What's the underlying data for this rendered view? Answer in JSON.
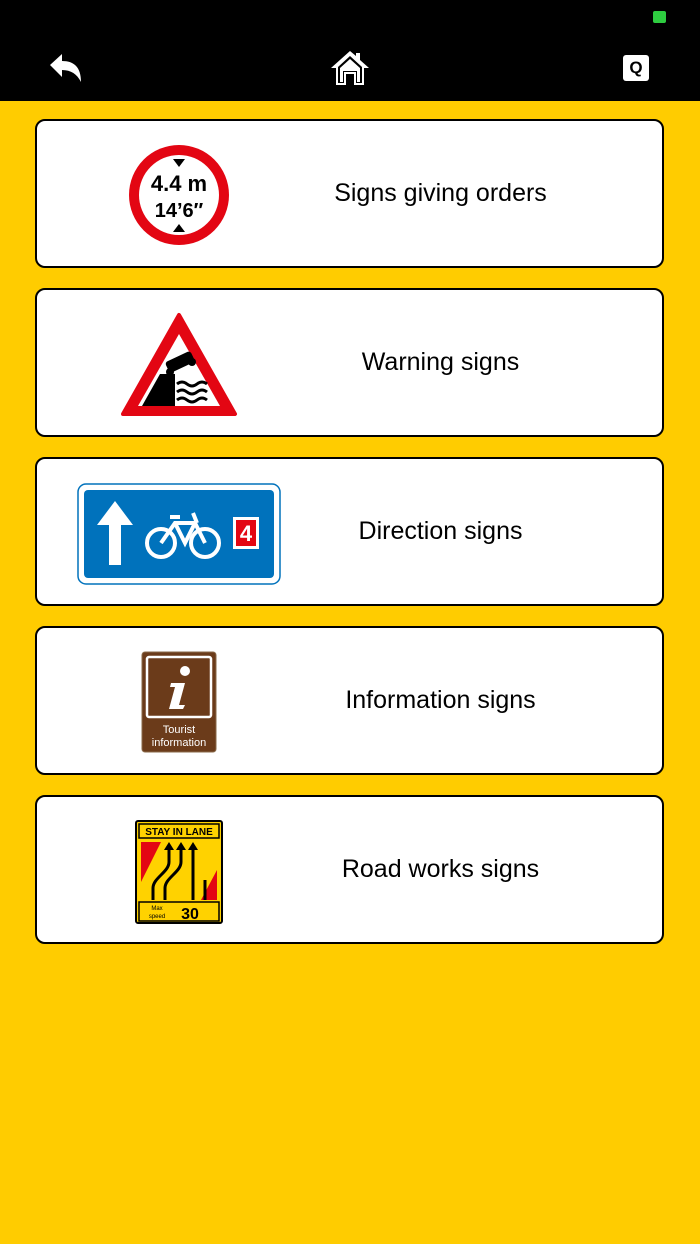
{
  "header": {
    "back_icon": "back-arrow-icon",
    "home_icon": "home-icon",
    "quiz_label": "Q"
  },
  "categories": [
    {
      "label": "Signs giving orders",
      "icon": "height-limit-sign-icon",
      "sign_text_top": "4.4 m",
      "sign_text_bottom": "14’6″"
    },
    {
      "label": "Warning signs",
      "icon": "quayside-warning-sign-icon"
    },
    {
      "label": "Direction signs",
      "icon": "cycle-route-sign-icon",
      "sign_text": "4"
    },
    {
      "label": "Information signs",
      "icon": "tourist-information-sign-icon",
      "sign_text_line1": "Tourist",
      "sign_text_line2": "information"
    },
    {
      "label": "Road works signs",
      "icon": "stay-in-lane-sign-icon",
      "sign_text_top": "STAY IN LANE",
      "sign_text_max": "Max",
      "sign_text_speed": "speed",
      "sign_text_value": "30"
    }
  ],
  "colors": {
    "background": "#FFCC00",
    "header": "#000000",
    "sign_red": "#E30613",
    "sign_blue": "#0072BC",
    "sign_brown": "#6B3B1A"
  }
}
